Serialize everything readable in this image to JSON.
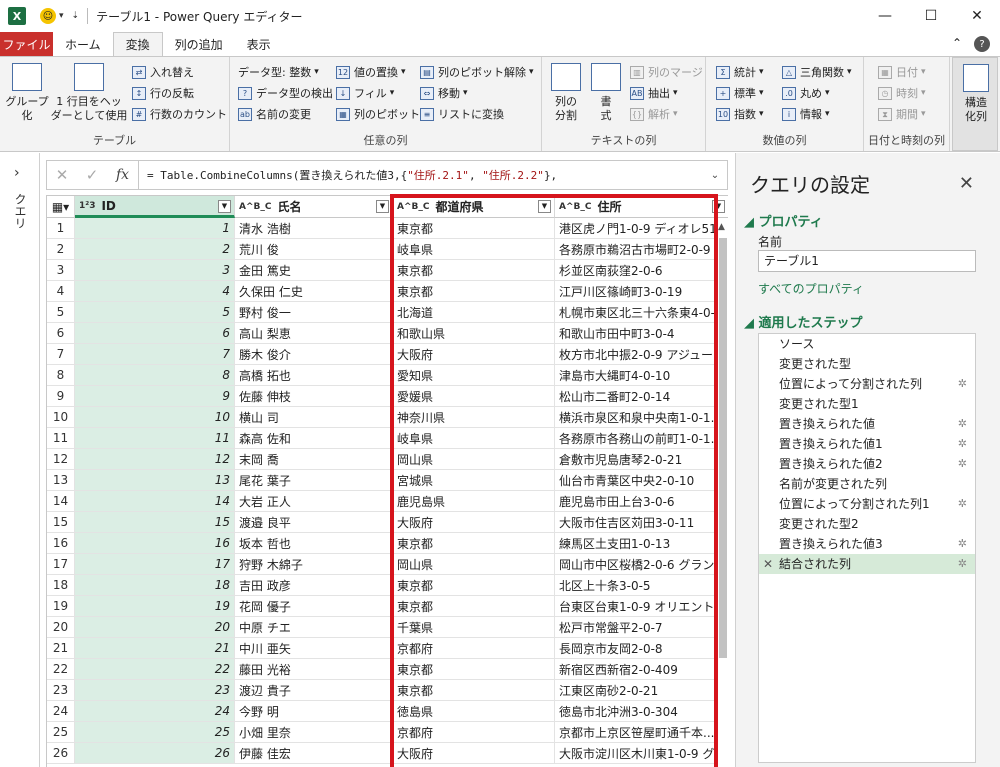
{
  "window": {
    "title": "テーブル1 - Power Query エディター",
    "logo": "X"
  },
  "tabs": [
    "ファイル",
    "ホーム",
    "変換",
    "列の追加",
    "表示"
  ],
  "ribbon": {
    "table": {
      "title": "テーブル",
      "group_by": "グループ\n化",
      "first_row": "1 行目をヘッ\nダーとして使用",
      "transpose": "入れ替え",
      "reverse_rows": "行の反転",
      "count_rows": "行数のカウント"
    },
    "any_column": {
      "title": "任意の列",
      "data_type": "データ型: 整数",
      "detect_type": "データ型の検出",
      "rename": "名前の変更",
      "replace_values": "値の置換",
      "fill": "フィル",
      "pivot": "列のピボット",
      "unpivot": "列のピボット解除",
      "move": "移動",
      "to_list": "リストに変換"
    },
    "text_column": {
      "title": "テキストの列",
      "split": "列の\n分割",
      "format": "書\n式",
      "merge": "列のマージ",
      "extract": "抽出",
      "parse": "解析"
    },
    "number_column": {
      "title": "数値の列",
      "stats": "統計",
      "standard": "標準",
      "scientific": "指数",
      "trig": "三角関数",
      "rounding": "丸め",
      "info": "情報"
    },
    "datetime": {
      "title": "日付と時刻の列",
      "date": "日付",
      "time": "時刻",
      "duration": "期間"
    },
    "structured": {
      "label": "構造\n化列"
    }
  },
  "left_panel": {
    "label": "クエリ"
  },
  "formula": {
    "prefix": "= Table.CombineColumns(置き換えられた値3,{",
    "s1": "\"住所.2.1\"",
    "mid": ", ",
    "s2": "\"住所.2.2\"",
    "suffix": "},"
  },
  "columns": [
    {
      "type": "1²3",
      "name": "ID"
    },
    {
      "type": "A^B_C",
      "name": "氏名"
    },
    {
      "type": "A^B_C",
      "name": "都道府県"
    },
    {
      "type": "A^B_C",
      "name": "住所"
    }
  ],
  "rows": [
    [
      "1",
      "清水 浩樹",
      "東京都",
      "港区虎ノ門1-0-9 ディオレ512"
    ],
    [
      "2",
      "荒川 俊",
      "岐阜県",
      "各務原市鵜沼古市場町2-0-9"
    ],
    [
      "3",
      "金田 篤史",
      "東京都",
      "杉並区南荻窪2-0-6"
    ],
    [
      "4",
      "久保田 仁史",
      "東京都",
      "江戸川区篠崎町3-0-19"
    ],
    [
      "5",
      "野村 俊一",
      "北海道",
      "札幌市東区北三十六条東4-0-9"
    ],
    [
      "6",
      "高山 梨恵",
      "和歌山県",
      "和歌山市田中町3-0-4"
    ],
    [
      "7",
      "勝木 俊介",
      "大阪府",
      "枚方市北中振2-0-9 アジュー..."
    ],
    [
      "8",
      "高橋 拓也",
      "愛知県",
      "津島市大縄町4-0-10"
    ],
    [
      "9",
      "佐藤 伸枝",
      "愛媛県",
      "松山市二番町2-0-14"
    ],
    [
      "10",
      "横山 司",
      "神奈川県",
      "横浜市泉区和泉中央南1-0-1..."
    ],
    [
      "11",
      "森高 佐和",
      "岐阜県",
      "各務原市各務山の前町1-0-1..."
    ],
    [
      "12",
      "末岡 喬",
      "岡山県",
      "倉敷市児島唐琴2-0-21"
    ],
    [
      "13",
      "尾花 葉子",
      "宮城県",
      "仙台市青葉区中央2-0-10"
    ],
    [
      "14",
      "大岩 正人",
      "鹿児島県",
      "鹿児島市田上台3-0-6"
    ],
    [
      "15",
      "渡邉 良平",
      "大阪府",
      "大阪市住吉区苅田3-0-11"
    ],
    [
      "16",
      "坂本 哲也",
      "東京都",
      "練馬区土支田1-0-13"
    ],
    [
      "17",
      "狩野 木綿子",
      "岡山県",
      "岡山市中区桜橋2-0-6 グラン..."
    ],
    [
      "18",
      "吉田 政彦",
      "東京都",
      "北区上十条3-0-5"
    ],
    [
      "19",
      "花岡 優子",
      "東京都",
      "台東区台東1-0-9 オリエント608"
    ],
    [
      "20",
      "中原 チエ",
      "千葉県",
      "松戸市常盤平2-0-7"
    ],
    [
      "21",
      "中川 亜矢",
      "京都府",
      "長岡京市友岡2-0-8"
    ],
    [
      "22",
      "藤田 光裕",
      "東京都",
      "新宿区西新宿2-0-409"
    ],
    [
      "23",
      "渡辺 貴子",
      "東京都",
      "江東区南砂2-0-21"
    ],
    [
      "24",
      "今野 明",
      "徳島県",
      "徳島市北沖洲3-0-304"
    ],
    [
      "25",
      "小畑 里奈",
      "京都府",
      "京都市上京区笹屋町通千本..."
    ],
    [
      "26",
      "伊藤 佳宏",
      "大阪府",
      "大阪市淀川区木川東1-0-9 グ..."
    ]
  ],
  "settings": {
    "title": "クエリの設定",
    "props_section": "プロパティ",
    "name_label": "名前",
    "name_value": "テーブル1",
    "all_props": "すべてのプロパティ",
    "steps_section": "適用したステップ",
    "steps": [
      {
        "label": "ソース",
        "gear": false
      },
      {
        "label": "変更された型",
        "gear": false
      },
      {
        "label": "位置によって分割された列",
        "gear": true
      },
      {
        "label": "変更された型1",
        "gear": false
      },
      {
        "label": "置き換えられた値",
        "gear": true
      },
      {
        "label": "置き換えられた値1",
        "gear": true
      },
      {
        "label": "置き換えられた値2",
        "gear": true
      },
      {
        "label": "名前が変更された列",
        "gear": false
      },
      {
        "label": "位置によって分割された列1",
        "gear": true
      },
      {
        "label": "変更された型2",
        "gear": false
      },
      {
        "label": "置き換えられた値3",
        "gear": true
      },
      {
        "label": "結合された列",
        "gear": true
      }
    ]
  }
}
